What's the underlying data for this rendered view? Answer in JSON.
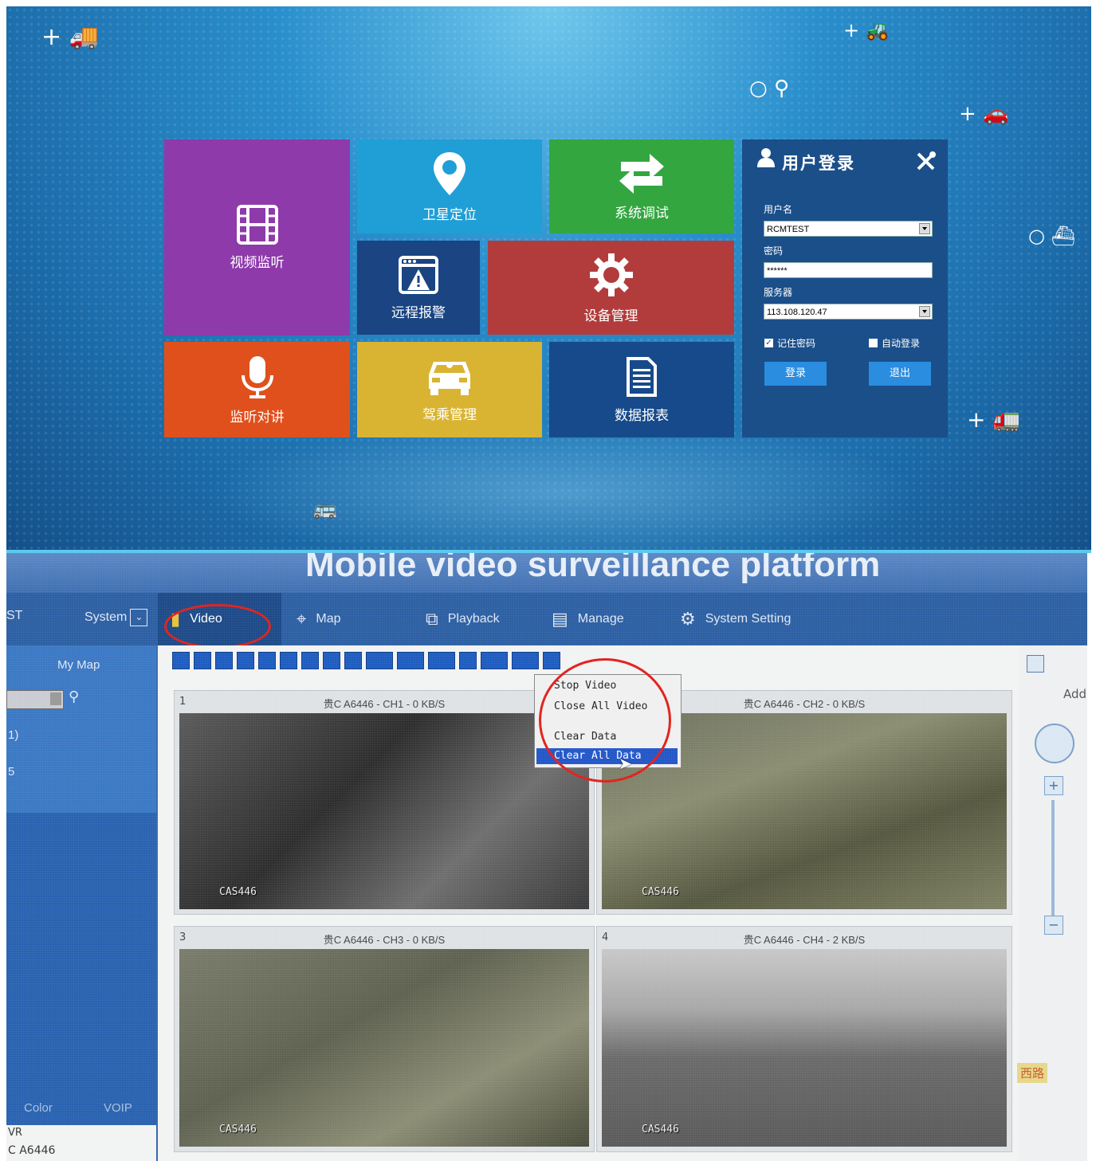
{
  "login_screen": {
    "tiles": {
      "video": "视频监听",
      "gps": "卫星定位",
      "system_debug": "系统调试",
      "remote_alarm": "远程报警",
      "device_mgmt": "设备管理",
      "intercom": "监听对讲",
      "driver_mgmt": "驾乘管理",
      "reports": "数据报表"
    },
    "tile_colors": {
      "video": "#8e3aab",
      "gps": "#1f9fd6",
      "system_debug": "#33a640",
      "remote_alarm": "#1a4482",
      "device_mgmt": "#b23c3c",
      "intercom": "#e0501c",
      "driver_mgmt": "#d9b432",
      "reports": "#174a8a"
    },
    "login": {
      "title": "用户登录",
      "username_label": "用户名",
      "username_value": "RCMTEST",
      "password_label": "密码",
      "password_value": "******",
      "server_label": "服务器",
      "server_value": "113.108.120.47",
      "remember_label": "记住密码",
      "remember_checked": true,
      "autologin_label": "自动登录",
      "autologin_checked": false,
      "login_button": "登录",
      "exit_button": "退出"
    }
  },
  "monitor": {
    "banner": "Mobile video surveillance platform",
    "left_fragment": "ST",
    "system_dropdown": "System",
    "nav": {
      "video": "Video",
      "map": "Map",
      "playback": "Playback",
      "manage": "Manage",
      "system_setting": "System Setting"
    },
    "my_map": "My Map",
    "left_items": [
      "1)",
      "5"
    ],
    "color_label": "Color",
    "voip_label": "VOIP",
    "bottom_left": [
      "VR",
      "C A6446"
    ],
    "add_label": "Add",
    "context_menu": [
      "Stop Video",
      "Close All Video",
      "Clear Data",
      "Clear All Data"
    ],
    "channels": [
      {
        "num": "1",
        "title": "贵C A6446 - CH1 - 0 KB/S",
        "watermark": "CAS446"
      },
      {
        "num": "",
        "title": "贵C A6446 - CH2 - 0 KB/S",
        "watermark": "CAS446"
      },
      {
        "num": "3",
        "title": "贵C A6446 - CH3 - 0 KB/S",
        "watermark": "CAS446"
      },
      {
        "num": "4",
        "title": "贵C A6446 - CH4 - 2 KB/S",
        "watermark": "CAS446"
      }
    ],
    "map_road_text": "西路"
  }
}
